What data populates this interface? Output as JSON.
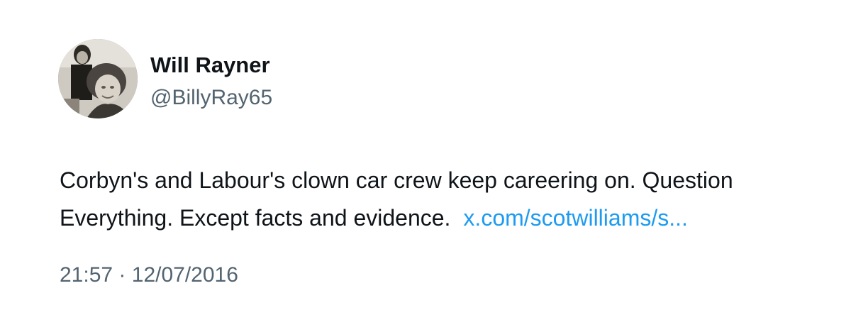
{
  "author": {
    "display_name": "Will Rayner",
    "handle": "@BillyRay65"
  },
  "tweet": {
    "line1": "Corbyn's and Labour's clown car crew keep careering on. Question",
    "line2": "Everything. Except facts and evidence.",
    "link_text": "x.com/scotwilliams/s..."
  },
  "meta": {
    "time": "21:57",
    "separator": "·",
    "date": "12/07/2016"
  },
  "colors": {
    "text": "#0f1419",
    "secondary": "#536471",
    "link": "#1d9bf0"
  }
}
